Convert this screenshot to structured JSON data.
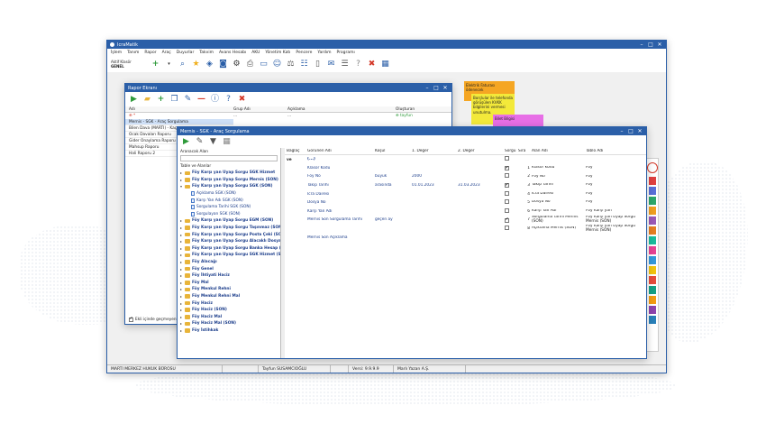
{
  "main_window": {
    "title": "IcraMatik",
    "menu": [
      "İşlem",
      "Tanım",
      "Rapor",
      "Araç",
      "Duyurlar",
      "Takvim",
      "Avans Hesabı",
      "AKU",
      "Yönetim Katı",
      "Pencere",
      "Yardım",
      "Programı"
    ],
    "top_left_labels": [
      "Aktif Klasör",
      "GENEL"
    ],
    "status": {
      "office": "MARTI MERKEZ HUKUK BÜROSU",
      "user": "Tayfun SUSAMCIOĞLU",
      "version": "Versi: 9.9.9.9",
      "mode": "Marlı Yazan A.Ş."
    }
  },
  "report_window": {
    "title": "Rapor Ekranı",
    "columns": [
      "Adı",
      "Grup Adı",
      "Açıklama",
      "Oluşturan"
    ],
    "filter_row": [
      "",
      "...",
      "...",
      "tayfun"
    ],
    "rows": [
      "Mernis - SGK - Araç Sorgulama",
      "Bilen Dava (MARTI) - Kaçış",
      "Ocak Davaları Raporu",
      "Gider Onaylama Raporu",
      "Mahsup Raporu",
      "Hali Raporu 2"
    ],
    "footer_checkbox": "Ekli içinde geçmeyen"
  },
  "sticky_notes": [
    {
      "text": "Elektrik Faturası ödenecek",
      "color": "#f5a623"
    },
    {
      "text": "Borçlular ile telefonda görüşülen KVKK bilgilerini vermesi unutulma.",
      "color": "#f3e93a"
    },
    {
      "text": "Bilet Bilgisi",
      "color": "#e76fe6"
    }
  ],
  "query_window": {
    "title": "Mernis - SGK - Araç Sorgulama",
    "search_label": "Aranacak Alan",
    "tables_label": "Table ve Alanlar",
    "tree": [
      {
        "label": "Föy Karşı yan Uyap Sorgu SGK Hizmet",
        "level": 0
      },
      {
        "label": "Föy Karşı yan Uyap Sorgu Mernis (SON)",
        "level": 0
      },
      {
        "label": "Föy Karşı yan Uyap Sorgu SGK (SON)",
        "level": 0,
        "open": true
      },
      {
        "label": "Açıklama SGK (SON)",
        "level": 1
      },
      {
        "label": "Karşı Yan Adı SGK (SON)",
        "level": 1
      },
      {
        "label": "Sorgulama Tarihi SGK (SON)",
        "level": 1
      },
      {
        "label": "Sorgulayan SGK (SON)",
        "level": 1
      },
      {
        "label": "Föy Karşı yan Uyap Sorgu EGM (SON)",
        "level": 0
      },
      {
        "label": "Föy Karşı yan Uyap Sorgu Taşınmaz (SON)",
        "level": 0
      },
      {
        "label": "Föy Karşı yan Uyap Sorgu Posta Çeki (SON)",
        "level": 0
      },
      {
        "label": "Föy Karşı yan Uyap Sorgu Alacaklı Dosya (SON)",
        "level": 0
      },
      {
        "label": "Föy Karşı yan Uyap Sorgu Banka Hesap (SON)",
        "level": 0
      },
      {
        "label": "Föy Karşı yan Uyap Sorgu SGK Hizmet (SON)",
        "level": 0
      },
      {
        "label": "Föy Alacağı",
        "level": 0
      },
      {
        "label": "Föy Genel",
        "level": 0
      },
      {
        "label": "Föy İhtiyati Haciz",
        "level": 0
      },
      {
        "label": "Föy Mal",
        "level": 0
      },
      {
        "label": "Föy Menkul Rehni",
        "level": 0
      },
      {
        "label": "Föy Menkul Rehni Mal",
        "level": 0
      },
      {
        "label": "Föy Haciz",
        "level": 0
      },
      {
        "label": "Föy Haciz (SON)",
        "level": 0
      },
      {
        "label": "Föy Haciz Mal",
        "level": 0
      },
      {
        "label": "Föy Haciz Mal (SON)",
        "level": 0
      },
      {
        "label": "Föy İstihkak",
        "level": 0
      }
    ],
    "grid_headers": [
      "Bağlaç",
      "Görünen Adı",
      "Koşul",
      "1. Değer",
      "2. Değer",
      "Sorgu",
      "Sıra",
      "Alan Adı",
      "Tablo Adı"
    ],
    "grid_first_link": "ve",
    "left_rows": [
      {
        "label": "(...)",
        "kosul": "",
        "d1": "",
        "d2": ""
      },
      {
        "label": "Klasör Kodu",
        "kosul": "",
        "d1": "",
        "d2": ""
      },
      {
        "label": "Föy No",
        "kosul": "büyük",
        "d1": "2000",
        "d2": ""
      },
      {
        "label": "Takip Tarihi",
        "kosul": "arasında",
        "d1": "01.01.2023",
        "d2": "31.03.2023"
      },
      {
        "label": "İcra Dairesi",
        "kosul": "",
        "d1": "",
        "d2": ""
      },
      {
        "label": "Dosya No",
        "kosul": "",
        "d1": "",
        "d2": ""
      },
      {
        "label": "Karşı Yan Adı",
        "kosul": "",
        "d1": "",
        "d2": ""
      },
      {
        "label": "Mernis Son Sorgulama Tarihi",
        "kosul": "geçen ay",
        "d1": "",
        "d2": ""
      },
      {
        "label": "",
        "kosul": "",
        "d1": "",
        "d2": ""
      },
      {
        "label": "Mernis Son Açıklama",
        "kosul": "",
        "d1": "",
        "d2": ""
      }
    ],
    "right_rows": [
      {
        "checked": false,
        "sira": "",
        "alan": "",
        "tablo": ""
      },
      {
        "checked": true,
        "sira": "1",
        "alan": "Klasör Kodu",
        "tablo": "Föy"
      },
      {
        "checked": false,
        "sira": "2",
        "alan": "Föy No",
        "tablo": "Föy"
      },
      {
        "checked": true,
        "sira": "3",
        "alan": "Takip Tarihi",
        "tablo": "Föy"
      },
      {
        "checked": false,
        "sira": "4",
        "alan": "İcra Dairesi",
        "tablo": "Föy"
      },
      {
        "checked": false,
        "sira": "5",
        "alan": "Dosya No",
        "tablo": "Föy"
      },
      {
        "checked": false,
        "sira": "6",
        "alan": "Karşı Yan Adı",
        "tablo": "Föy Karşı yan"
      },
      {
        "checked": true,
        "sira": "7",
        "alan": "Sorgulama Tarihi Mernis (SON)",
        "tablo": "Föy Karşı yan Uyap Sorgu Mernis (SON)"
      },
      {
        "checked": false,
        "sira": "8",
        "alan": "Açıklama Mernis (SON)",
        "tablo": "Föy Karşı yan Uyap Sorgu Mernis (SON)"
      }
    ]
  },
  "colors": {
    "titlebar": "#2b5fa8",
    "link_blue": "#1a3c8a",
    "accent_green": "#2e9a3a",
    "accent_red": "#d43a2a"
  },
  "side_palette": [
    "#e04040",
    "#5a6fd8",
    "#2ca76b",
    "#f0a020",
    "#9b59b6",
    "#e67e22",
    "#1abc9c",
    "#e84393",
    "#3498db",
    "#f1c40f",
    "#e74c3c",
    "#16a085",
    "#f39c12",
    "#8e44ad",
    "#2980b9"
  ]
}
